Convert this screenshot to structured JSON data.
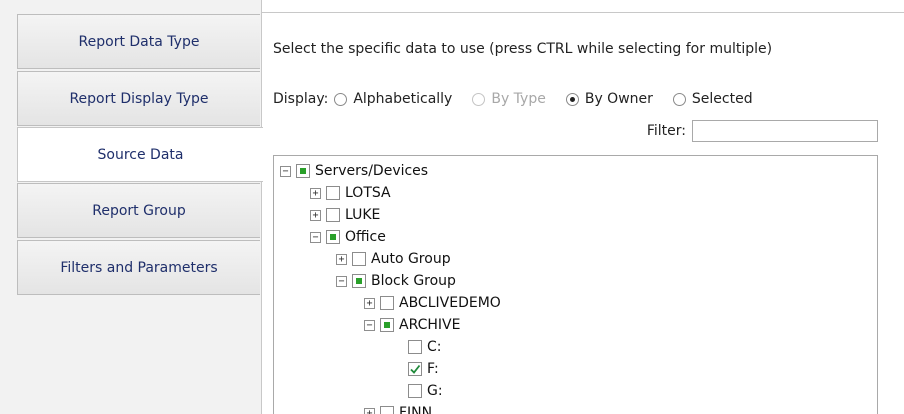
{
  "tabs": [
    {
      "label": "Report Data Type",
      "active": false
    },
    {
      "label": "Report Display Type",
      "active": false
    },
    {
      "label": "Source Data",
      "active": true
    },
    {
      "label": "Report Group",
      "active": false
    },
    {
      "label": "Filters and Parameters",
      "active": false
    }
  ],
  "instruction": "Select the specific data to use (press CTRL while selecting for multiple)",
  "display": {
    "label": "Display:",
    "options": [
      {
        "label": "Alphabetically",
        "selected": false,
        "enabled": true
      },
      {
        "label": "By Type",
        "selected": false,
        "enabled": false
      },
      {
        "label": "By Owner",
        "selected": true,
        "enabled": true
      },
      {
        "label": "Selected",
        "selected": false,
        "enabled": true
      }
    ]
  },
  "filter": {
    "label": "Filter:",
    "value": ""
  },
  "tree": [
    {
      "label": "Servers/Devices",
      "expander": "minus",
      "state": "partial"
    },
    {
      "label": "LOTSA",
      "expander": "plus",
      "state": "unchecked"
    },
    {
      "label": "LUKE",
      "expander": "plus",
      "state": "unchecked"
    },
    {
      "label": "Office",
      "expander": "minus",
      "state": "partial"
    },
    {
      "label": "Auto Group",
      "expander": "plus",
      "state": "unchecked"
    },
    {
      "label": "Block Group",
      "expander": "minus",
      "state": "partial"
    },
    {
      "label": "ABCLIVEDEMO",
      "expander": "plus",
      "state": "unchecked"
    },
    {
      "label": "ARCHIVE",
      "expander": "minus",
      "state": "partial"
    },
    {
      "label": "C:",
      "expander": "none",
      "state": "unchecked"
    },
    {
      "label": "F:",
      "expander": "none",
      "state": "checked"
    },
    {
      "label": "G:",
      "expander": "none",
      "state": "unchecked"
    },
    {
      "label": "FINN",
      "expander": "plus",
      "state": "unchecked"
    }
  ],
  "colors": {
    "tab_text": "#1f2f6b",
    "partial_fill": "#2aa02a",
    "check_mark": "#1f8a3a"
  }
}
